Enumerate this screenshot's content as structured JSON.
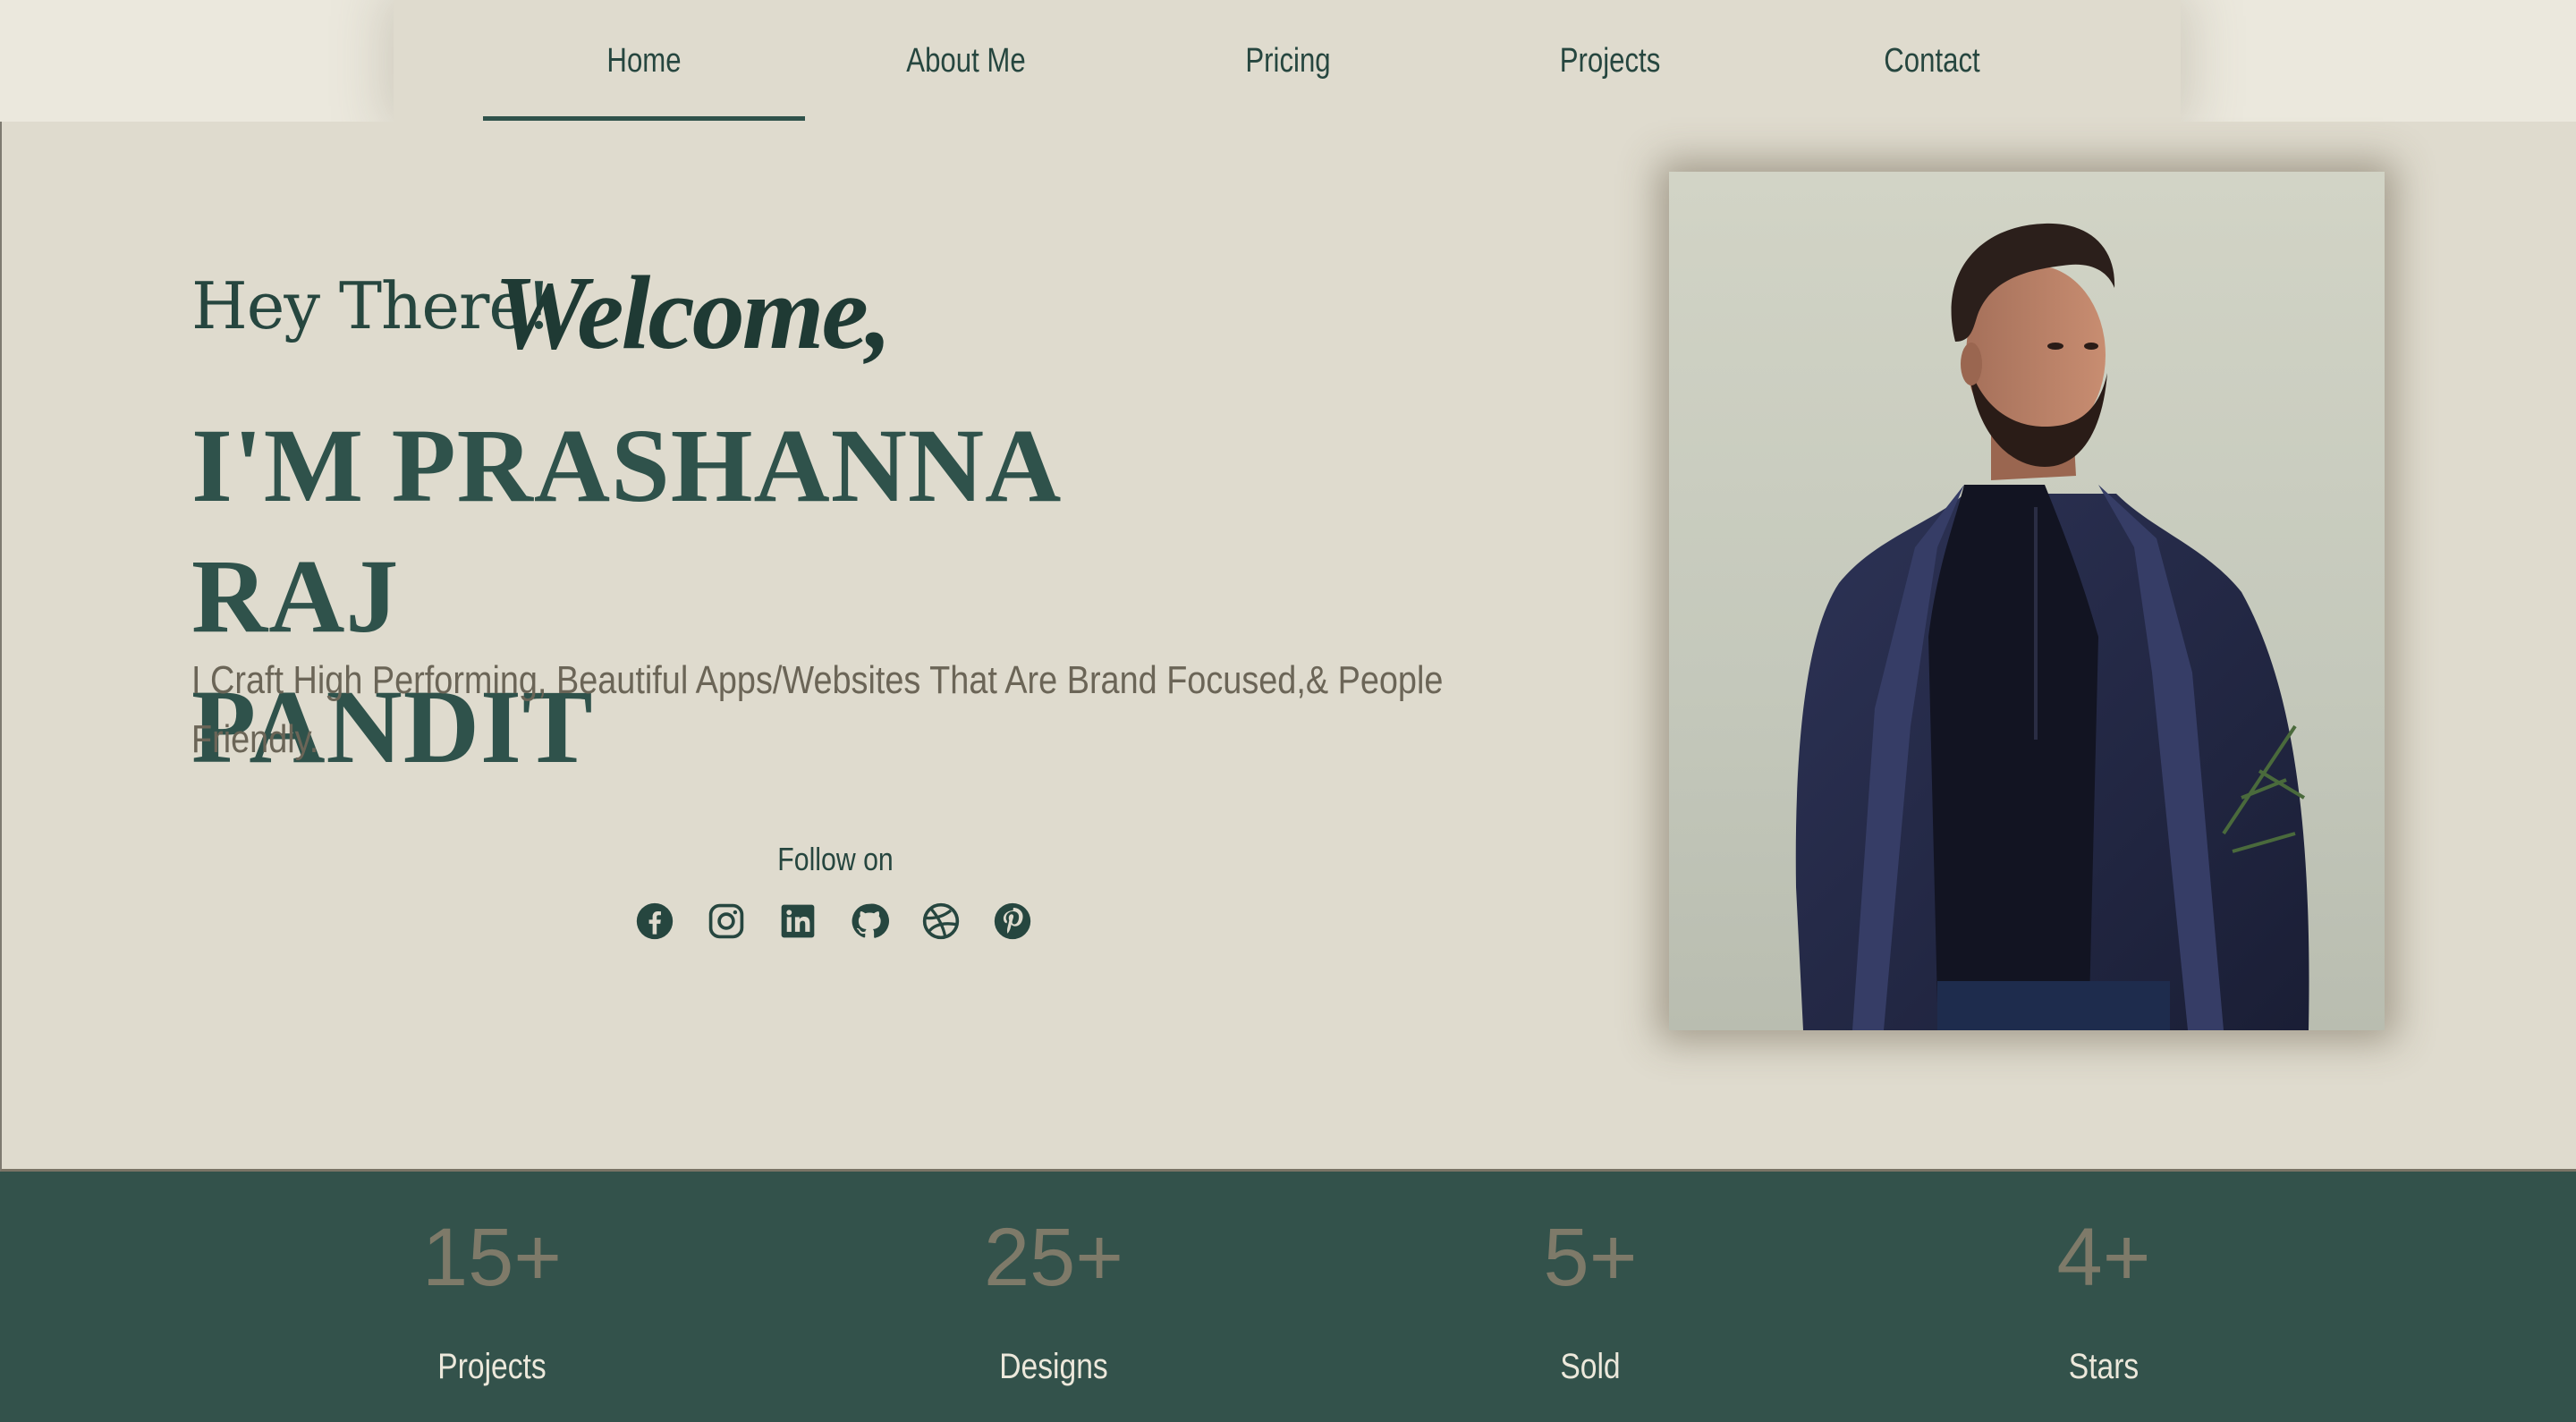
{
  "nav": {
    "items": [
      {
        "label": "Home",
        "active": true
      },
      {
        "label": "About Me"
      },
      {
        "label": "Pricing"
      },
      {
        "label": "Projects"
      },
      {
        "label": "Contact"
      }
    ]
  },
  "hero": {
    "greeting": "Hey There!",
    "welcome": "Welcome,",
    "name_line1": "I'M PRASHANNA RAJ",
    "name_line2": "PANDIT",
    "tagline": "I Craft High Performing, Beautiful Apps/Websites That Are Brand Focused,& People Friendly.",
    "follow_label": "Follow on",
    "socials": [
      "facebook-icon",
      "instagram-icon",
      "linkedin-icon",
      "github-icon",
      "dribbble-icon",
      "pinterest-icon"
    ]
  },
  "stats": [
    {
      "value": "15+",
      "label": "Projects"
    },
    {
      "value": "25+",
      "label": "Designs"
    },
    {
      "value": "5+",
      "label": "Sold"
    },
    {
      "value": "4+",
      "label": "Stars"
    }
  ],
  "colors": {
    "background": "#dfdbce",
    "accent": "#2f524b",
    "stats_band": "#33524b",
    "muted_text": "#6b6557"
  }
}
